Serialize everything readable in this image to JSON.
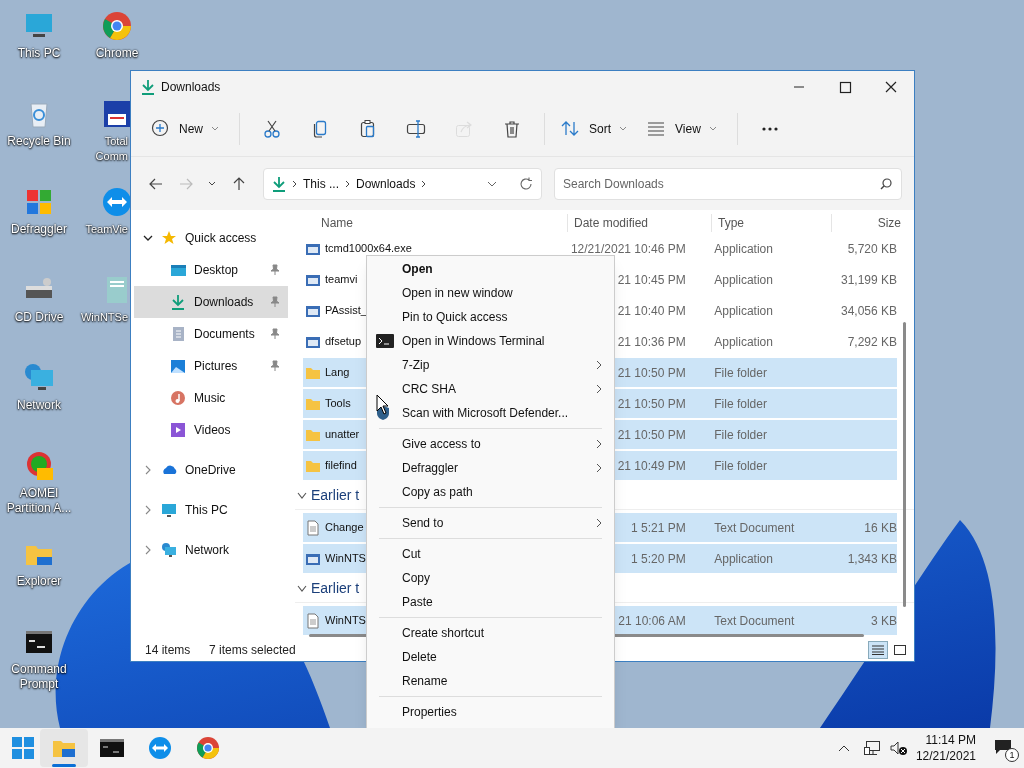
{
  "desktop_icons": [
    {
      "label": "This PC"
    },
    {
      "label": "Chrome"
    },
    {
      "label": "Recycle Bin"
    },
    {
      "label": "Total Comm"
    },
    {
      "label": "Defraggler"
    },
    {
      "label": "TeamVie"
    },
    {
      "label": "CD Drive"
    },
    {
      "label": "WinNTSe"
    },
    {
      "label": "Network"
    },
    {
      "label": "AOMEI Partition A..."
    },
    {
      "label": "Explorer"
    },
    {
      "label": "Command Prompt"
    }
  ],
  "window": {
    "title": "Downloads"
  },
  "toolbar": [
    {
      "kind": "new",
      "label": "New",
      "disabled": false
    },
    {
      "kind": "cut",
      "disabled": false
    },
    {
      "kind": "copy",
      "disabled": false
    },
    {
      "kind": "paste",
      "disabled": false
    },
    {
      "kind": "rename",
      "disabled": false
    },
    {
      "kind": "share",
      "disabled": true
    },
    {
      "kind": "delete",
      "disabled": false
    },
    {
      "kind": "sort",
      "label": "Sort",
      "disabled": false
    },
    {
      "kind": "view",
      "label": "View",
      "disabled": false
    },
    {
      "kind": "more",
      "disabled": false
    }
  ],
  "address": {
    "back_disabled": false,
    "forward_disabled": true,
    "crumbs": [
      "This ...",
      "Downloads"
    ],
    "search_placeholder": "Search Downloads"
  },
  "sidebar": [
    {
      "label": "Quick access",
      "expanded": true,
      "selected": false,
      "children": [
        {
          "label": "Desktop",
          "pinned": true,
          "selected": false
        },
        {
          "label": "Downloads",
          "pinned": true,
          "selected": true
        },
        {
          "label": "Documents",
          "pinned": true,
          "selected": false
        },
        {
          "label": "Pictures",
          "pinned": true,
          "selected": false
        },
        {
          "label": "Music",
          "pinned": false,
          "selected": false
        },
        {
          "label": "Videos",
          "pinned": false,
          "selected": false
        }
      ]
    },
    {
      "label": "OneDrive",
      "expanded": false,
      "selected": false
    },
    {
      "label": "This PC",
      "expanded": false,
      "selected": false
    },
    {
      "label": "Network",
      "expanded": false,
      "selected": false
    }
  ],
  "columns": [
    "Name",
    "Date modified",
    "Type",
    "Size"
  ],
  "rows": [
    {
      "kind": "app",
      "name": "tcmd1000x64.exe",
      "date": "12/21/2021 10:46 PM",
      "type": "Application",
      "size": "5,720 KB",
      "selected": false
    },
    {
      "kind": "app",
      "name": "teamvi",
      "date": "21 10:45 PM",
      "type": "Application",
      "size": "31,199 KB",
      "selected": false
    },
    {
      "kind": "app",
      "name": "PAssist_",
      "date": "21 10:40 PM",
      "type": "Application",
      "size": "34,056 KB",
      "selected": false
    },
    {
      "kind": "app",
      "name": "dfsetup",
      "date": "21 10:36 PM",
      "type": "Application",
      "size": "7,292 KB",
      "selected": false
    },
    {
      "kind": "folder",
      "name": "Lang",
      "date": "21 10:50 PM",
      "type": "File folder",
      "selected": true
    },
    {
      "kind": "folder",
      "name": "Tools",
      "date": "21 10:50 PM",
      "type": "File folder",
      "selected": true
    },
    {
      "kind": "folder",
      "name": "unatter",
      "date": "21 10:50 PM",
      "type": "File folder",
      "selected": true
    },
    {
      "kind": "folder",
      "name": "filefind",
      "date": "21 10:49 PM",
      "type": "File folder",
      "selected": true
    },
    {
      "kind": "group",
      "name": "Earlier t"
    },
    {
      "kind": "text",
      "name": "Change",
      "date": "1 5:21 PM",
      "type": "Text Document",
      "size": "16 KB",
      "selected": true
    },
    {
      "kind": "app",
      "name": "WinNTS",
      "date": "1 5:20 PM",
      "type": "Application",
      "size": "1,343 KB",
      "selected": true
    },
    {
      "kind": "group",
      "name": "Earlier t"
    },
    {
      "kind": "text",
      "name": "WinNTS",
      "date": "21 10:06 AM",
      "type": "Text Document",
      "size": "3 KB",
      "selected": true
    }
  ],
  "status_bar": {
    "count": "14 items",
    "selection": "7 items selected"
  },
  "context_menu": [
    {
      "kind": "item",
      "label": "Open",
      "default": true,
      "submenu": false
    },
    {
      "kind": "item",
      "label": "Open in new window",
      "default": false,
      "submenu": false
    },
    {
      "kind": "item",
      "label": "Pin to Quick access",
      "default": false,
      "submenu": false
    },
    {
      "kind": "terminal-item",
      "label": "Open in Windows Terminal",
      "default": false,
      "submenu": false
    },
    {
      "kind": "item",
      "label": "7-Zip",
      "default": false,
      "submenu": true
    },
    {
      "kind": "item",
      "label": "CRC SHA",
      "default": false,
      "submenu": true
    },
    {
      "kind": "shield-item",
      "label": "Scan with Microsoft Defender...",
      "default": false,
      "submenu": false
    },
    {
      "kind": "separator"
    },
    {
      "kind": "item",
      "label": "Give access to",
      "default": false,
      "submenu": true
    },
    {
      "kind": "item",
      "label": "Defraggler",
      "default": false,
      "submenu": true
    },
    {
      "kind": "item",
      "label": "Copy as path",
      "default": false,
      "submenu": false
    },
    {
      "kind": "separator"
    },
    {
      "kind": "item",
      "label": "Send to",
      "default": false,
      "submenu": true
    },
    {
      "kind": "separator"
    },
    {
      "kind": "item",
      "label": "Cut",
      "default": false,
      "submenu": false
    },
    {
      "kind": "item",
      "label": "Copy",
      "default": false,
      "submenu": false
    },
    {
      "kind": "item",
      "label": "Paste",
      "default": false,
      "submenu": false
    },
    {
      "kind": "separator"
    },
    {
      "kind": "item",
      "label": "Create shortcut",
      "default": false,
      "submenu": false
    },
    {
      "kind": "item",
      "label": "Delete",
      "default": false,
      "submenu": false
    },
    {
      "kind": "item",
      "label": "Rename",
      "default": false,
      "submenu": false
    },
    {
      "kind": "separator"
    },
    {
      "kind": "item",
      "label": "Properties",
      "default": false,
      "submenu": false
    }
  ],
  "taskbar": {
    "apps": [
      {
        "kind": "explorer",
        "active": true
      },
      {
        "kind": "terminal",
        "active": false
      },
      {
        "kind": "remote",
        "active": false
      },
      {
        "kind": "browser",
        "active": false
      }
    ],
    "time": "11:14 PM",
    "date": "12/21/2021",
    "notifications": "1"
  }
}
